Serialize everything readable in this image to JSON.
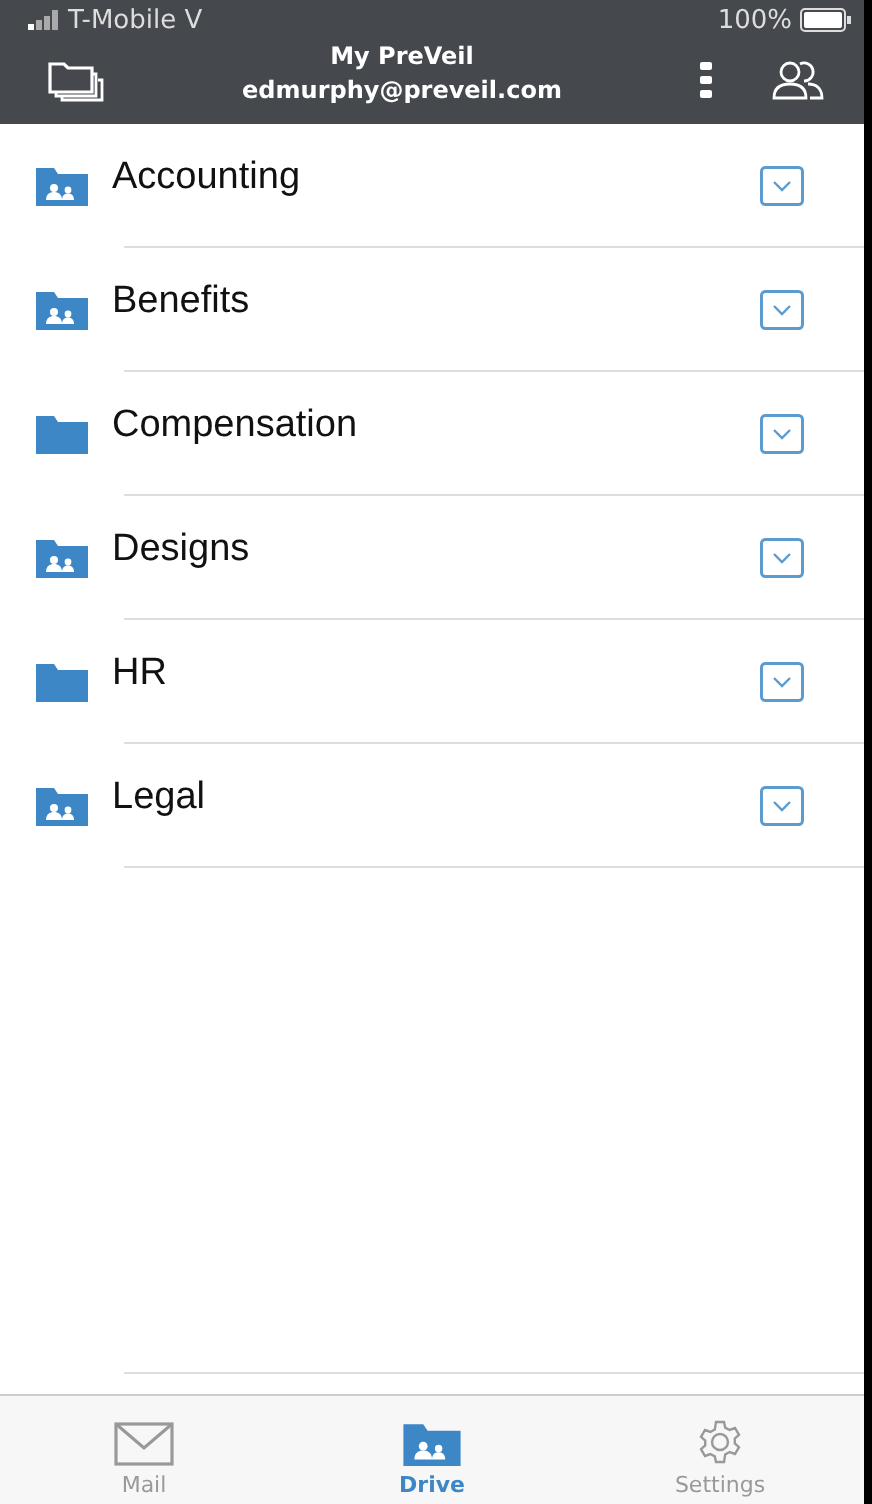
{
  "status_bar": {
    "carrier": "T-Mobile V",
    "battery": "100%"
  },
  "header": {
    "title": "My PreVeil",
    "account": "edmurphy@preveil.com"
  },
  "folders": [
    {
      "name": "Accounting",
      "kind": "shared"
    },
    {
      "name": "Benefits",
      "kind": "shared"
    },
    {
      "name": "Compensation",
      "kind": "plain"
    },
    {
      "name": "Designs",
      "kind": "shared"
    },
    {
      "name": "HR",
      "kind": "plain"
    },
    {
      "name": "Legal",
      "kind": "shared"
    }
  ],
  "tabs": [
    {
      "label": "Mail",
      "kind": "mail",
      "selected": false
    },
    {
      "label": "Drive",
      "kind": "drive",
      "selected": true
    },
    {
      "label": "Settings",
      "kind": "settings",
      "selected": false
    }
  ]
}
